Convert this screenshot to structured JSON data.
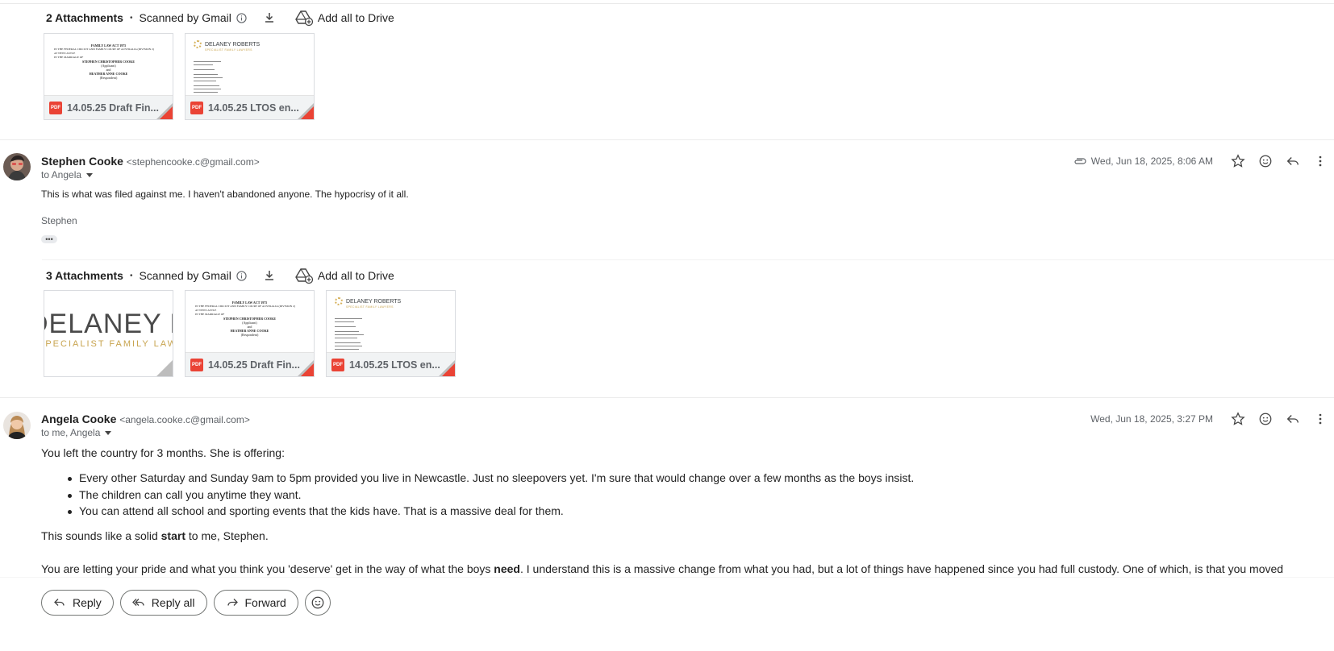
{
  "attachments_top": {
    "count_label": "2 Attachments",
    "scanned_label": "Scanned by Gmail",
    "add_drive_label": "Add all to Drive",
    "files": [
      {
        "name": "14.05.25 Draft Fin...",
        "type": "PDF"
      },
      {
        "name": "14.05.25 LTOS en...",
        "type": "PDF"
      }
    ]
  },
  "thumb_text": {
    "act_title": "FAMILY LAW ACT 1975",
    "court_line": "IN THE FEDERAL CIRCUIT AND FAMILY COURT OF AUSTRALIA (DIVISION 2)",
    "registry": "AT NEWCASTLE",
    "marriage": "IN THE MARRIAGE OF",
    "applicant_name": "STEPHEN CHRISTOPHER COOKE",
    "applicant_role": "(Applicant)",
    "and_label": "and",
    "respondent_name": "HEATHER ANNE COOKE",
    "respondent_role": "(Respondent)",
    "firm_name": "DELANEY ROBERTS",
    "firm_sub": "SPECIALIST FAMILY LAWYERS",
    "big_logo": "DELANEY ROBERTS",
    "big_sub": "SPECIALIST FAMILY LAWYERS"
  },
  "message1": {
    "sender_name": "Stephen Cooke",
    "sender_email": "<stephencooke.c@gmail.com>",
    "to_label": "to Angela",
    "date": "Wed, Jun 18, 2025, 8:06 AM",
    "body": "This is what was filed against me. I haven't abandoned anyone. The hypocrisy of it all.",
    "signature": "Stephen",
    "more_label": "•••"
  },
  "attachments_mid": {
    "count_label": "3 Attachments",
    "scanned_label": "Scanned by Gmail",
    "add_drive_label": "Add all to Drive",
    "files": [
      {
        "name": "",
        "type": "image"
      },
      {
        "name": "14.05.25 Draft Fin...",
        "type": "PDF"
      },
      {
        "name": "14.05.25 LTOS en...",
        "type": "PDF"
      }
    ]
  },
  "message2": {
    "sender_name": "Angela Cooke",
    "sender_email": "<angela.cooke.c@gmail.com>",
    "to_label": "to me, Angela",
    "date": "Wed, Jun 18, 2025, 3:27 PM",
    "intro": "You left the country for 3 months. She is offering:",
    "bullets": [
      "Every other Saturday and Sunday 9am to 5pm provided you live in Newcastle. Just no sleepovers yet. I'm sure that would change over a few months as the boys insist.",
      "The children can call you anytime they want.",
      "You can attend all school and sporting events that the kids have. That is a massive deal for them."
    ],
    "line2_pre": "This sounds like a solid ",
    "line2_bold": "start",
    "line2_post": " to me, Stephen.",
    "line3_pre": "You are letting your pride and what you think you 'deserve' get in the way of what the boys ",
    "line3_bold": "need",
    "line3_post": ". I understand this is a massive change from what you had, but a lot of things have happened since you had full custody. One of which, is that you moved"
  },
  "actions": {
    "reply": "Reply",
    "reply_all": "Reply all",
    "forward": "Forward"
  },
  "pdf_badge": "PDF",
  "colors": {
    "pdf_red": "#ea4335",
    "accent_gold": "#c8a44f",
    "text_secondary": "#5f6368"
  }
}
